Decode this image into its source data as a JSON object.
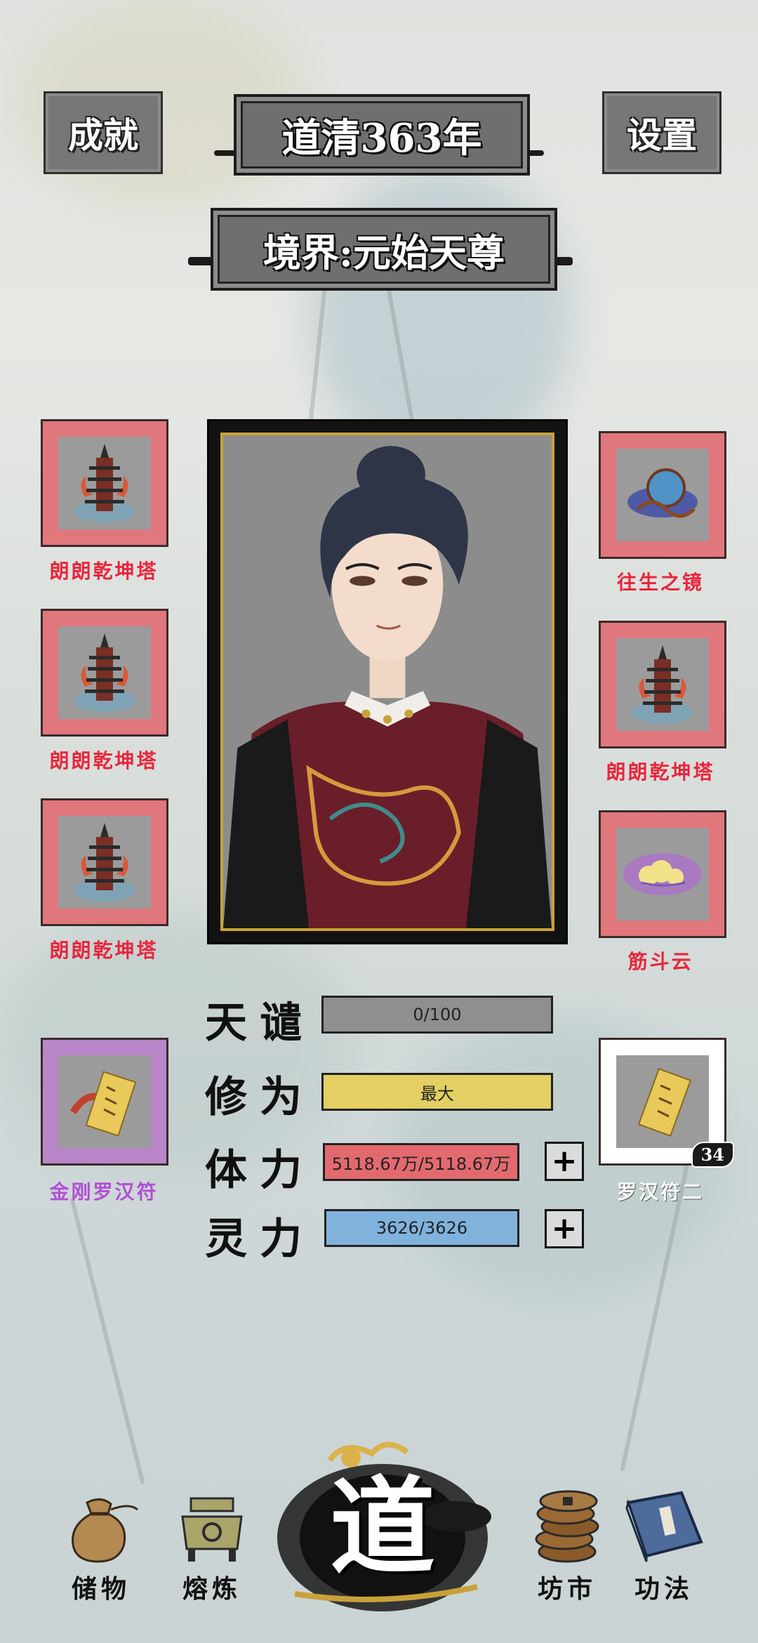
{
  "top": {
    "achievements_label": "成就",
    "year_label": "道清363年",
    "settings_label": "设置"
  },
  "realm_label": "境界:元始天尊",
  "left_items": [
    {
      "name": "朗朗乾坤塔",
      "icon": "pagoda-icon"
    },
    {
      "name": "朗朗乾坤塔",
      "icon": "pagoda-icon"
    },
    {
      "name": "朗朗乾坤塔",
      "icon": "pagoda-icon"
    }
  ],
  "right_items": [
    {
      "name": "往生之镜",
      "icon": "mirror-icon"
    },
    {
      "name": "朗朗乾坤塔",
      "icon": "pagoda-icon"
    },
    {
      "name": "筋斗云",
      "icon": "cloud-icon"
    }
  ],
  "talisman_left": {
    "name": "金刚罗汉符",
    "icon": "talisman-icon"
  },
  "talisman_right": {
    "name": "罗汉符二",
    "icon": "talisman-icon",
    "count": "34"
  },
  "stats": {
    "tribulation": {
      "label": "天谴",
      "value": "0/100",
      "fill": 0.0
    },
    "cultivation": {
      "label": "修为",
      "value": "最大",
      "fill": 1.0
    },
    "stamina": {
      "label": "体力",
      "value": "5118.67万/5118.67万",
      "fill": 1.0
    },
    "spirit": {
      "label": "灵力",
      "value": "3626/3626",
      "fill": 1.0
    }
  },
  "nav": {
    "storage": "储物",
    "refine": "熔炼",
    "dao": "道",
    "market": "坊市",
    "skills": "功法"
  },
  "colors": {
    "slot_red": "#e0777d",
    "slot_purple": "#b986c9",
    "item_label_red": "#e8263c",
    "item_label_purple": "#b14fd6",
    "cultivation_bar": "#e3cf63",
    "stamina_bar": "#e26a6f",
    "spirit_bar": "#7fb3dc",
    "tribulation_bar": "#8f8f8f",
    "gold": "#c9a13a"
  }
}
